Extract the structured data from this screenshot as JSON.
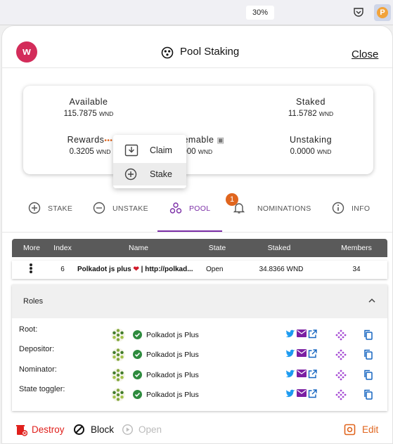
{
  "browser": {
    "zoom": "30%"
  },
  "header": {
    "logo_letter": "w",
    "title": "Pool Staking",
    "close_label": "Close"
  },
  "balances": {
    "unit": "WND",
    "available_label": "Available",
    "available_value": "115.7875",
    "staked_label": "Staked",
    "staked_value": "11.5782",
    "rewards_label": "Rewards",
    "rewards_value": "0.3205",
    "redeemable_label": "eemable",
    "redeemable_value": "0000",
    "unstaking_label": "Unstaking",
    "unstaking_value": "0.0000"
  },
  "context_menu": {
    "items": [
      {
        "label": "Claim",
        "icon": "download-icon"
      },
      {
        "label": "Stake",
        "icon": "add-circle-icon"
      }
    ]
  },
  "tabs": [
    {
      "label": "STAKE",
      "icon": "add-circle-icon"
    },
    {
      "label": "UNSTAKE",
      "icon": "remove-circle-icon"
    },
    {
      "label": "POOL",
      "icon": "pool-icon",
      "active": true
    },
    {
      "label": "NOMINATIONS",
      "icon": "bell-icon",
      "badge": "1"
    },
    {
      "label": "INFO",
      "icon": "info-icon"
    }
  ],
  "table": {
    "headers": [
      "More",
      "Index",
      "Name",
      "State",
      "Staked",
      "Members"
    ],
    "row": {
      "index": "6",
      "name": "Polkadot js plus",
      "name_rest": "| http://polkad...",
      "state": "Open",
      "staked": "34.8366 WND",
      "members": "34"
    }
  },
  "roles": {
    "title": "Roles",
    "rows": [
      {
        "label": "Root:",
        "account": "Polkadot js Plus"
      },
      {
        "label": "Depositor:",
        "account": "Polkadot js Plus"
      },
      {
        "label": "Nominator:",
        "account": "Polkadot js Plus"
      },
      {
        "label": "State toggler:",
        "account": "Polkadot js Plus"
      }
    ]
  },
  "footer": {
    "destroy": "Destroy",
    "block": "Block",
    "open": "Open",
    "edit": "Edit"
  },
  "colors": {
    "accent": "#7b2ea6",
    "danger": "#e0201c",
    "orange": "#e0651e",
    "header_row": "#5a5a5a",
    "twitter": "#1d9bf0"
  }
}
